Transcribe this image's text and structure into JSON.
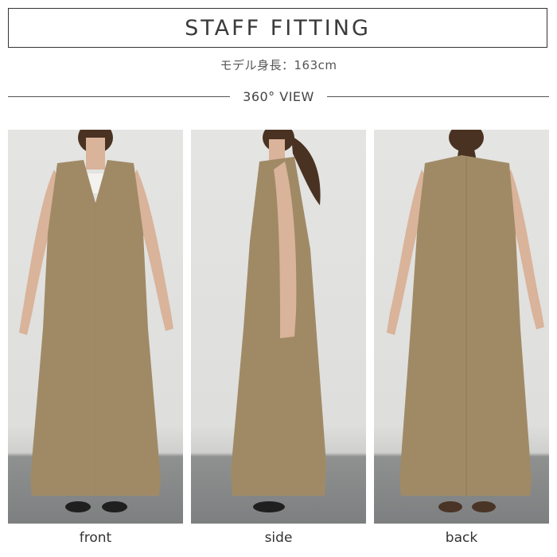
{
  "header": {
    "title": "STAFF FITTING",
    "model_height": "モデル身長：163cm",
    "view_label": "360° VIEW"
  },
  "photos": [
    {
      "caption": "front"
    },
    {
      "caption": "side"
    },
    {
      "caption": "back"
    }
  ],
  "colors": {
    "dress": "#a08a66",
    "wall": "#e4e4e2",
    "floor": "#7f8182",
    "skin": "#d9b39a",
    "hair": "#4a3222"
  }
}
